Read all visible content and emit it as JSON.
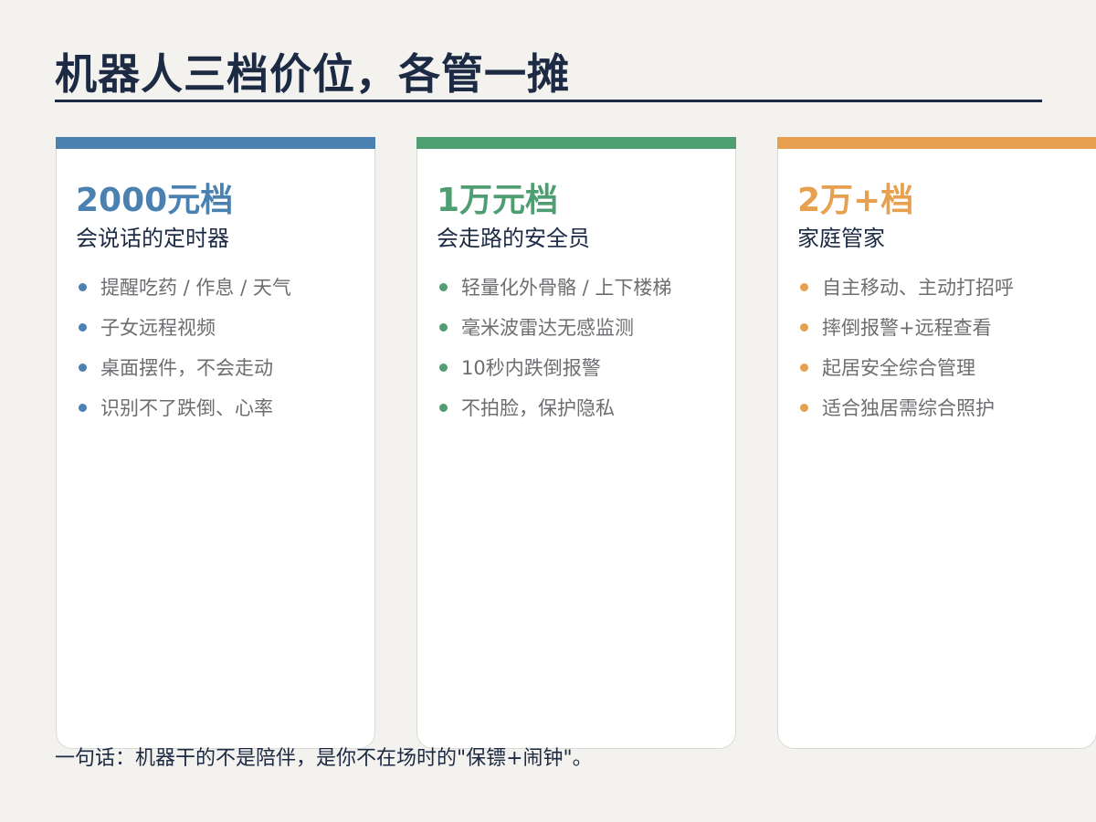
{
  "title": "机器人三档价位，各管一摊",
  "colors": {
    "title": "#1c2a44",
    "tier_blue": "#4a81b0",
    "tier_green": "#4f9e72",
    "tier_orange": "#e7a04f",
    "bullet_text": "#6e6e72",
    "background": "#f3f2ee"
  },
  "tiers": [
    {
      "price": "2000元档",
      "subtitle": "会说话的定时器",
      "accent": "#4a81b0",
      "items": [
        "提醒吃药 / 作息 / 天气",
        "子女远程视频",
        "桌面摆件，不会走动",
        "识别不了跌倒、心率"
      ]
    },
    {
      "price": "1万元档",
      "subtitle": "会走路的安全员",
      "accent": "#4f9e72",
      "items": [
        "轻量化外骨骼 / 上下楼梯",
        "毫米波雷达无感监测",
        "10秒内跌倒报警",
        "不拍脸，保护隐私"
      ]
    },
    {
      "price": "2万+档",
      "subtitle": "家庭管家",
      "accent": "#e7a04f",
      "items": [
        "自主移动、主动打招呼",
        "摔倒报警+远程查看",
        "起居安全综合管理",
        "适合独居需综合照护"
      ]
    }
  ],
  "footer": "一句话：机器干的不是陪伴，是你不在场时的\"保镖+闹钟\"。"
}
